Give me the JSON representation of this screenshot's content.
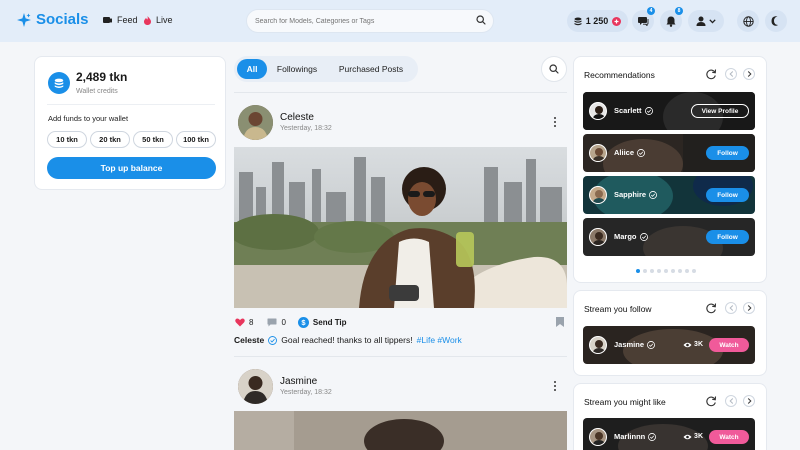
{
  "header": {
    "logo": "Socials",
    "nav": [
      {
        "label": "Feed",
        "icon": "feed-icon"
      },
      {
        "label": "Live",
        "icon": "flame-icon"
      }
    ],
    "search_placeholder": "Search for Models, Categories or Tags",
    "balance": "1 250",
    "messages_badge": "4",
    "notifications_badge": "8"
  },
  "wallet": {
    "amount": "2,489 tkn",
    "label": "Wallet credits",
    "add_funds": "Add funds to your wallet",
    "amounts": [
      "10 tkn",
      "20 tkn",
      "50 tkn",
      "100 tkn"
    ],
    "topup": "Top up balance"
  },
  "feed": {
    "tabs": [
      {
        "label": "All",
        "active": true
      },
      {
        "label": "Followings",
        "active": false
      },
      {
        "label": "Purchased Posts",
        "active": false
      }
    ],
    "posts": [
      {
        "name": "Celeste",
        "time": "Yesterday, 18:32",
        "likes": "8",
        "comments": "0",
        "send_tip": "Send Tip",
        "caption_text": "Goal reached! thanks to all tippers!",
        "hashtags": "#Life #Work"
      },
      {
        "name": "Jasmine",
        "time": "Yesterday, 18:32"
      }
    ]
  },
  "recommendations": {
    "title": "Recommendations",
    "items": [
      {
        "name": "Scarlett",
        "button": "View Profile"
      },
      {
        "name": "Aliice",
        "button": "Follow"
      },
      {
        "name": "Sapphire",
        "button": "Follow"
      },
      {
        "name": "Margo",
        "button": "Follow"
      }
    ],
    "pages": 9,
    "current_page": 1
  },
  "stream_follow": {
    "title": "Stream you follow",
    "items": [
      {
        "name": "Jasmine",
        "viewers": "3K",
        "button": "Watch"
      }
    ]
  },
  "stream_like": {
    "title": "Stream you might like",
    "items": [
      {
        "name": "Marlinnn",
        "viewers": "3K",
        "button": "Watch"
      }
    ]
  },
  "colors": {
    "accent": "#1a8fe8",
    "watch": "#f05a9a",
    "like": "#e8365d"
  }
}
